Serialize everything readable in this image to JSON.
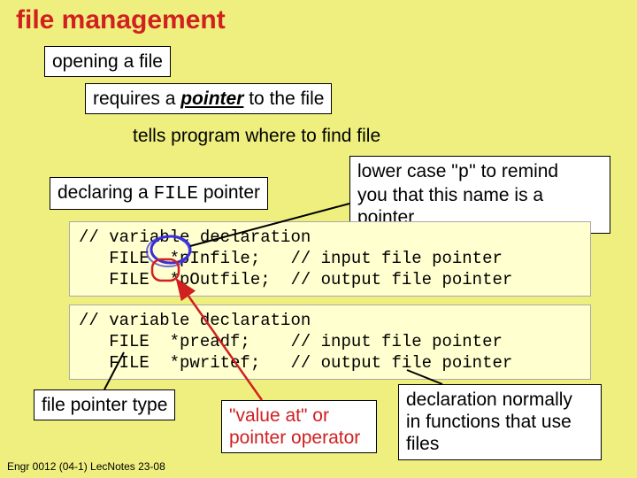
{
  "title": "file management",
  "box_opening": "opening a file",
  "line_requires_pre": "requires a ",
  "line_requires_pointer": "pointer",
  "line_requires_post": " to the file",
  "line_tells": "tells program where to find file",
  "box_declaring_pre": "declaring a ",
  "box_declaring_file": "FILE",
  "box_declaring_post": " pointer",
  "box_tip_l1_pre": "lower case \"",
  "box_tip_l1_p": "p",
  "box_tip_l1_post": "\" to remind",
  "box_tip_l2": "you that this name is a",
  "box_tip_l3": "pointer",
  "code1_l1": "// variable declaration",
  "code1_l2": "   FILE  *pInfile;   // input file pointer",
  "code1_l3": "   FILE  *pOutfile;  // output file pointer",
  "code2_l1": "// variable declaration",
  "code2_l2": "   FILE  *preadf;    // input file pointer",
  "code2_l3": "   FILE  *pwritef;   // output file pointer",
  "box_filetype": "file pointer type",
  "box_valueat_l1": "\"value at\" or",
  "box_valueat_l2": "pointer operator",
  "box_decl_l1": "declaration normally",
  "box_decl_l2": "in functions that use",
  "box_decl_l3": "files",
  "footer": "Engr 0012 (04-1) LecNotes 23-08"
}
